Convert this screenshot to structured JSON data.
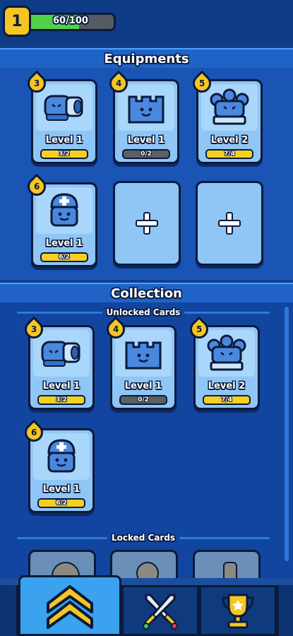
{
  "player": {
    "level": "1",
    "xp_text": "60/100",
    "xp_progress": 0.6
  },
  "equipments": {
    "title": "Equipments",
    "cards": [
      {
        "cost": "3",
        "level": "Level 1",
        "progress": "3/2",
        "unit": "cannon"
      },
      {
        "cost": "4",
        "level": "Level 1",
        "progress": "0/2",
        "unit": "wall"
      },
      {
        "cost": "5",
        "level": "Level 2",
        "progress": "7/4",
        "unit": "triple-turret"
      },
      {
        "cost": "6",
        "level": "Level 1",
        "progress": "6/2",
        "unit": "medic"
      }
    ]
  },
  "collection": {
    "title": "Collection",
    "unlocked_label": "Unlocked Cards",
    "locked_label": "Locked Cards",
    "cards": [
      {
        "cost": "3",
        "level": "Level 1",
        "progress": "3/2",
        "unit": "cannon"
      },
      {
        "cost": "4",
        "level": "Level 1",
        "progress": "0/2",
        "unit": "wall"
      },
      {
        "cost": "5",
        "level": "Level 2",
        "progress": "7/4",
        "unit": "triple-turret"
      },
      {
        "cost": "6",
        "level": "Level 1",
        "progress": "6/2",
        "unit": "medic"
      }
    ]
  },
  "nav": {
    "tabs": [
      {
        "name": "upgrade",
        "icon": "double-chevron-up-icon",
        "active": true
      },
      {
        "name": "battle",
        "icon": "crossed-swords-icon",
        "active": false
      },
      {
        "name": "trophy",
        "icon": "trophy-icon",
        "active": false
      }
    ]
  },
  "colors": {
    "accent_yellow": "#f5c522",
    "xp_green": "#4fd14a",
    "card_blue": "#8fc6f5",
    "background": "#0f3f8a"
  }
}
